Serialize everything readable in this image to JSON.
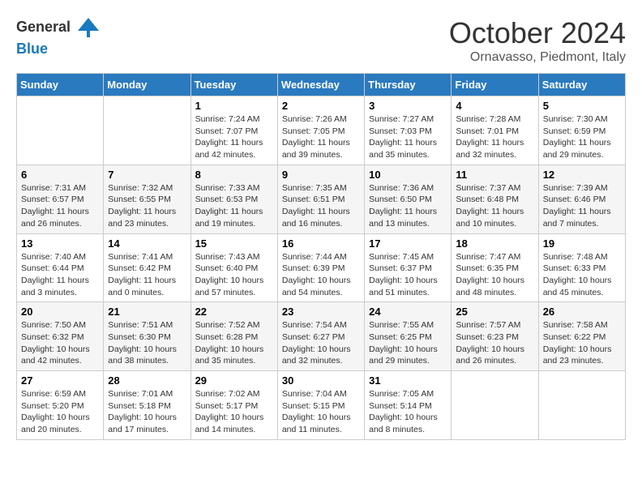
{
  "logo": {
    "text_general": "General",
    "text_blue": "Blue"
  },
  "title": {
    "month": "October 2024",
    "location": "Ornavasso, Piedmont, Italy"
  },
  "header_days": [
    "Sunday",
    "Monday",
    "Tuesday",
    "Wednesday",
    "Thursday",
    "Friday",
    "Saturday"
  ],
  "weeks": [
    {
      "days": [
        {
          "number": "",
          "info": ""
        },
        {
          "number": "",
          "info": ""
        },
        {
          "number": "1",
          "info": "Sunrise: 7:24 AM\nSunset: 7:07 PM\nDaylight: 11 hours and 42 minutes."
        },
        {
          "number": "2",
          "info": "Sunrise: 7:26 AM\nSunset: 7:05 PM\nDaylight: 11 hours and 39 minutes."
        },
        {
          "number": "3",
          "info": "Sunrise: 7:27 AM\nSunset: 7:03 PM\nDaylight: 11 hours and 35 minutes."
        },
        {
          "number": "4",
          "info": "Sunrise: 7:28 AM\nSunset: 7:01 PM\nDaylight: 11 hours and 32 minutes."
        },
        {
          "number": "5",
          "info": "Sunrise: 7:30 AM\nSunset: 6:59 PM\nDaylight: 11 hours and 29 minutes."
        }
      ]
    },
    {
      "days": [
        {
          "number": "6",
          "info": "Sunrise: 7:31 AM\nSunset: 6:57 PM\nDaylight: 11 hours and 26 minutes."
        },
        {
          "number": "7",
          "info": "Sunrise: 7:32 AM\nSunset: 6:55 PM\nDaylight: 11 hours and 23 minutes."
        },
        {
          "number": "8",
          "info": "Sunrise: 7:33 AM\nSunset: 6:53 PM\nDaylight: 11 hours and 19 minutes."
        },
        {
          "number": "9",
          "info": "Sunrise: 7:35 AM\nSunset: 6:51 PM\nDaylight: 11 hours and 16 minutes."
        },
        {
          "number": "10",
          "info": "Sunrise: 7:36 AM\nSunset: 6:50 PM\nDaylight: 11 hours and 13 minutes."
        },
        {
          "number": "11",
          "info": "Sunrise: 7:37 AM\nSunset: 6:48 PM\nDaylight: 11 hours and 10 minutes."
        },
        {
          "number": "12",
          "info": "Sunrise: 7:39 AM\nSunset: 6:46 PM\nDaylight: 11 hours and 7 minutes."
        }
      ]
    },
    {
      "days": [
        {
          "number": "13",
          "info": "Sunrise: 7:40 AM\nSunset: 6:44 PM\nDaylight: 11 hours and 3 minutes."
        },
        {
          "number": "14",
          "info": "Sunrise: 7:41 AM\nSunset: 6:42 PM\nDaylight: 11 hours and 0 minutes."
        },
        {
          "number": "15",
          "info": "Sunrise: 7:43 AM\nSunset: 6:40 PM\nDaylight: 10 hours and 57 minutes."
        },
        {
          "number": "16",
          "info": "Sunrise: 7:44 AM\nSunset: 6:39 PM\nDaylight: 10 hours and 54 minutes."
        },
        {
          "number": "17",
          "info": "Sunrise: 7:45 AM\nSunset: 6:37 PM\nDaylight: 10 hours and 51 minutes."
        },
        {
          "number": "18",
          "info": "Sunrise: 7:47 AM\nSunset: 6:35 PM\nDaylight: 10 hours and 48 minutes."
        },
        {
          "number": "19",
          "info": "Sunrise: 7:48 AM\nSunset: 6:33 PM\nDaylight: 10 hours and 45 minutes."
        }
      ]
    },
    {
      "days": [
        {
          "number": "20",
          "info": "Sunrise: 7:50 AM\nSunset: 6:32 PM\nDaylight: 10 hours and 42 minutes."
        },
        {
          "number": "21",
          "info": "Sunrise: 7:51 AM\nSunset: 6:30 PM\nDaylight: 10 hours and 38 minutes."
        },
        {
          "number": "22",
          "info": "Sunrise: 7:52 AM\nSunset: 6:28 PM\nDaylight: 10 hours and 35 minutes."
        },
        {
          "number": "23",
          "info": "Sunrise: 7:54 AM\nSunset: 6:27 PM\nDaylight: 10 hours and 32 minutes."
        },
        {
          "number": "24",
          "info": "Sunrise: 7:55 AM\nSunset: 6:25 PM\nDaylight: 10 hours and 29 minutes."
        },
        {
          "number": "25",
          "info": "Sunrise: 7:57 AM\nSunset: 6:23 PM\nDaylight: 10 hours and 26 minutes."
        },
        {
          "number": "26",
          "info": "Sunrise: 7:58 AM\nSunset: 6:22 PM\nDaylight: 10 hours and 23 minutes."
        }
      ]
    },
    {
      "days": [
        {
          "number": "27",
          "info": "Sunrise: 6:59 AM\nSunset: 5:20 PM\nDaylight: 10 hours and 20 minutes."
        },
        {
          "number": "28",
          "info": "Sunrise: 7:01 AM\nSunset: 5:18 PM\nDaylight: 10 hours and 17 minutes."
        },
        {
          "number": "29",
          "info": "Sunrise: 7:02 AM\nSunset: 5:17 PM\nDaylight: 10 hours and 14 minutes."
        },
        {
          "number": "30",
          "info": "Sunrise: 7:04 AM\nSunset: 5:15 PM\nDaylight: 10 hours and 11 minutes."
        },
        {
          "number": "31",
          "info": "Sunrise: 7:05 AM\nSunset: 5:14 PM\nDaylight: 10 hours and 8 minutes."
        },
        {
          "number": "",
          "info": ""
        },
        {
          "number": "",
          "info": ""
        }
      ]
    }
  ]
}
